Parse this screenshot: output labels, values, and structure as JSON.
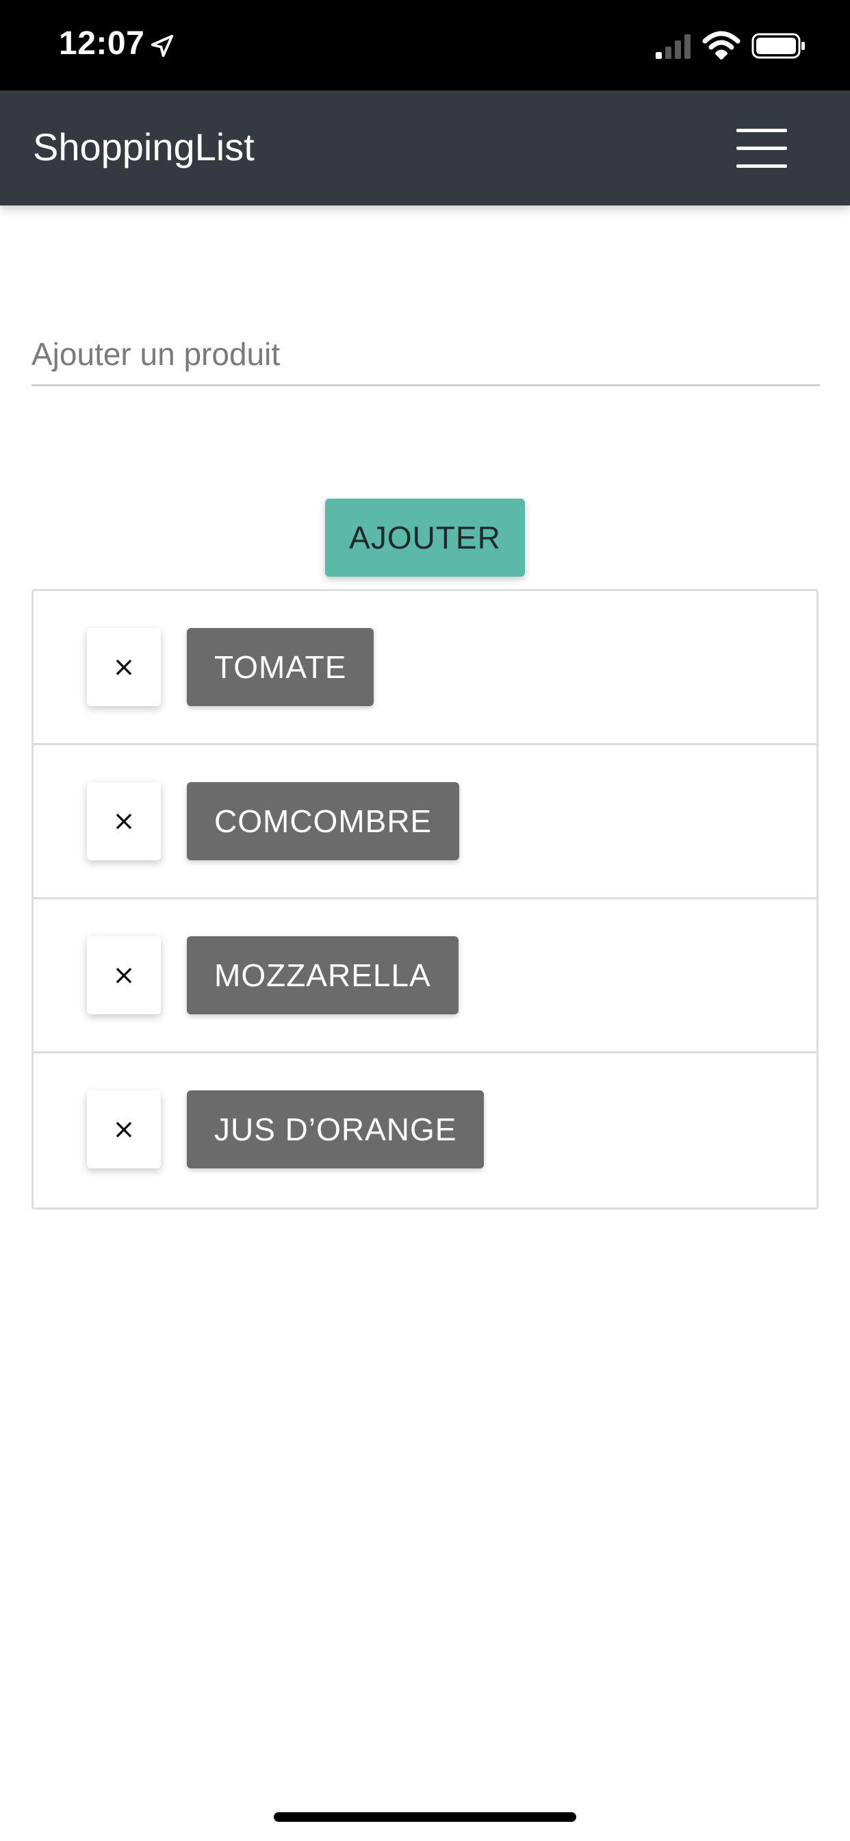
{
  "status_bar": {
    "time": "12:07",
    "icons": [
      "location-arrow-icon",
      "cellular-signal-icon",
      "wifi-icon",
      "battery-icon"
    ]
  },
  "navbar": {
    "brand": "ShoppingList",
    "menu_icon": "hamburger-menu-icon"
  },
  "form": {
    "input_placeholder": "Ajouter un produit",
    "input_value": "",
    "add_label": "AJOUTER"
  },
  "items": [
    {
      "delete_label": "×",
      "label": "TOMATE"
    },
    {
      "delete_label": "×",
      "label": "COMCOMBRE"
    },
    {
      "delete_label": "×",
      "label": "MOZZARELLA"
    },
    {
      "delete_label": "×",
      "label": "JUS D’ORANGE"
    }
  ],
  "colors": {
    "navbar_bg": "#343a40",
    "add_button_bg": "#5cb8a9",
    "item_chip_bg": "#6b6b6b",
    "status_bar_bg": "#000000"
  }
}
